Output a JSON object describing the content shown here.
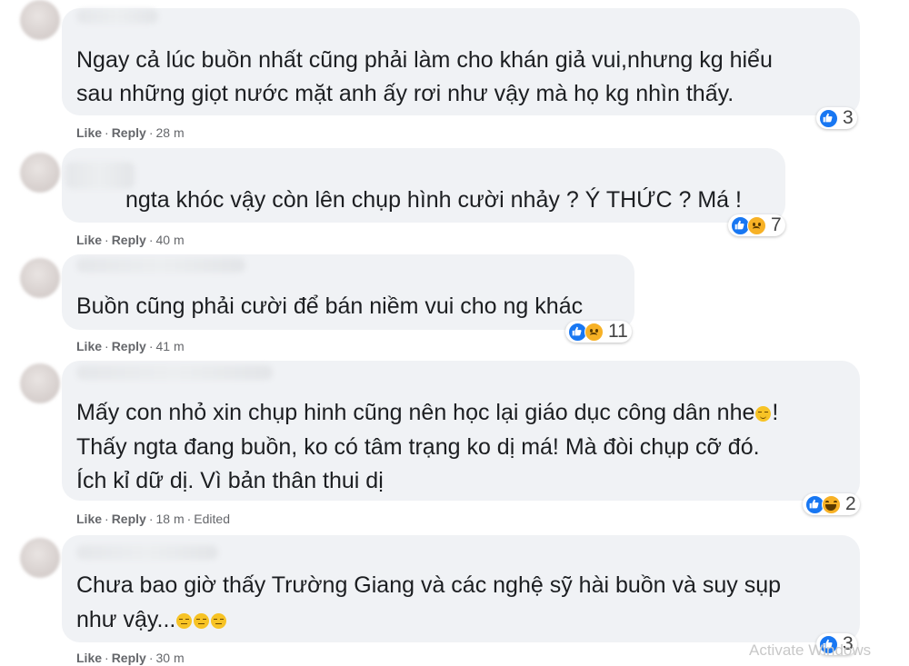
{
  "actions": {
    "like": "Like",
    "reply": "Reply",
    "edited": "Edited"
  },
  "comments": [
    {
      "lines": [
        "Ngay cả lúc buồn nhất cũng phải làm cho khán giả vui,nhưng kg hiểu",
        "sau những giọt nước mặt anh ấy rơi như vậy mà họ kg nhìn thấy."
      ],
      "time": "28 m",
      "reactions": {
        "types": [
          "like-icon"
        ],
        "count": "3"
      }
    },
    {
      "lines": [
        "ngta khóc vậy còn lên chụp hình cười nhảy ? Ý THỨC ? Má !"
      ],
      "time": "40 m",
      "reactions": {
        "types": [
          "like-icon",
          "sad-icon"
        ],
        "count": "7"
      }
    },
    {
      "lines": [
        "Buồn cũng phải cười để bán niềm vui cho ng khác"
      ],
      "time": "41 m",
      "reactions": {
        "types": [
          "like-icon",
          "sad-icon"
        ],
        "count": "11"
      }
    },
    {
      "lines": [
        "Mấy con nhỏ xin chụp hinh cũng nên học lại giáo dục công dân nhe",
        "Thấy ngta đang buồn, ko có tâm trạng ko dị má! Mà đòi chụp cỡ đó.",
        "Ích kỉ dữ dị. Vì bản thân thui dị"
      ],
      "line1_suffix": "!",
      "time": "18 m",
      "reactions": {
        "types": [
          "like-icon",
          "haha-icon"
        ],
        "count": "2"
      }
    },
    {
      "lines": [
        "Chưa bao giờ thấy Trường Giang và các nghệ sỹ hài buồn và suy sụp",
        "như vậy..."
      ],
      "time": "30 m",
      "reactions": {
        "types": [
          "like-icon"
        ],
        "count": "3"
      }
    }
  ],
  "watermark": "Activate Windows"
}
